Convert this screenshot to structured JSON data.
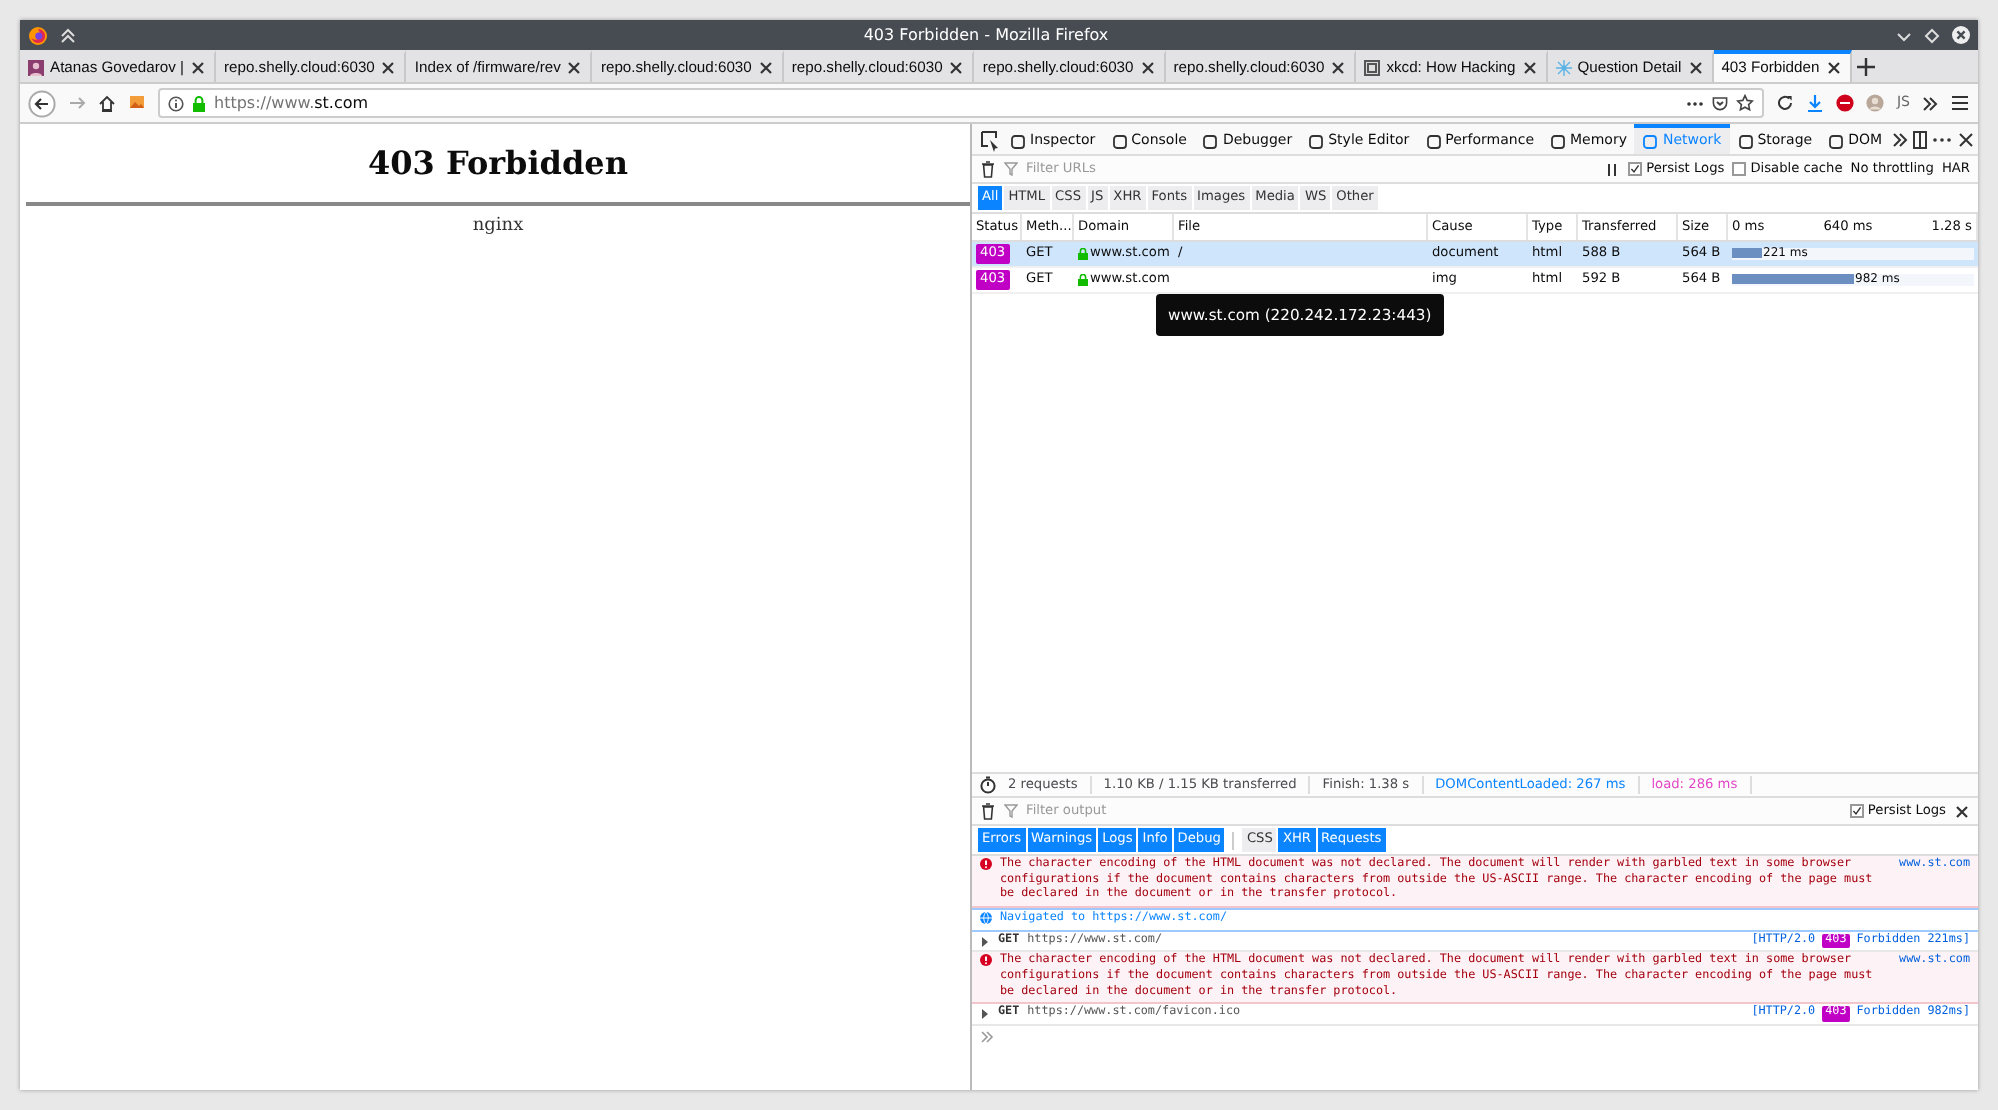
{
  "window": {
    "title": "403 Forbidden - Mozilla Firefox"
  },
  "tabs": [
    {
      "title": "Atanas Govedarov |",
      "kind": "avatar",
      "selected": false
    },
    {
      "title": "repo.shelly.cloud:6030",
      "kind": "plain",
      "selected": false
    },
    {
      "title": "Index of /firmware/rev",
      "kind": "plain",
      "selected": false
    },
    {
      "title": "repo.shelly.cloud:6030",
      "kind": "plain",
      "selected": false
    },
    {
      "title": "repo.shelly.cloud:6030",
      "kind": "plain",
      "selected": false
    },
    {
      "title": "repo.shelly.cloud:6030",
      "kind": "plain",
      "selected": false
    },
    {
      "title": "repo.shelly.cloud:6030",
      "kind": "plain",
      "selected": false
    },
    {
      "title": "xkcd: How Hacking",
      "kind": "comic",
      "selected": false
    },
    {
      "title": "Question Detail",
      "kind": "network",
      "selected": false
    },
    {
      "title": "403 Forbidden",
      "kind": "plain",
      "selected": true
    }
  ],
  "address_bar": {
    "url_prefix": "https://www.",
    "url_host": "st.com"
  },
  "toolbar": {
    "js_button": "JS"
  },
  "page": {
    "heading": "403 Forbidden",
    "footer": "nginx"
  },
  "devtools": {
    "tools": [
      {
        "label": "Inspector",
        "selected": false
      },
      {
        "label": "Console",
        "selected": false
      },
      {
        "label": "Debugger",
        "selected": false
      },
      {
        "label": "Style Editor",
        "selected": false
      },
      {
        "label": "Performance",
        "selected": false
      },
      {
        "label": "Memory",
        "selected": false
      },
      {
        "label": "Network",
        "selected": true
      },
      {
        "label": "Storage",
        "selected": false
      },
      {
        "label": "DOM",
        "selected": false
      }
    ],
    "network": {
      "filter_placeholder": "Filter URLs",
      "persist_logs": {
        "label": "Persist Logs",
        "checked": true
      },
      "disable_cache": {
        "label": "Disable cache",
        "checked": false
      },
      "throttling": "No throttling",
      "har": "HAR",
      "type_filters": [
        {
          "label": "All",
          "selected": true
        },
        {
          "label": "HTML",
          "selected": false
        },
        {
          "label": "CSS",
          "selected": false
        },
        {
          "label": "JS",
          "selected": false
        },
        {
          "label": "XHR",
          "selected": false
        },
        {
          "label": "Fonts",
          "selected": false
        },
        {
          "label": "Images",
          "selected": false
        },
        {
          "label": "Media",
          "selected": false
        },
        {
          "label": "WS",
          "selected": false
        },
        {
          "label": "Other",
          "selected": false
        }
      ],
      "columns": [
        "Status",
        "Meth...",
        "Domain",
        "File",
        "Cause",
        "Type",
        "Transferred",
        "Size"
      ],
      "timeline_ticks": [
        "0 ms",
        "640 ms",
        "1.28 s"
      ],
      "rows": [
        {
          "status": "403",
          "method": "GET",
          "domain": "www.st.com",
          "file": "/",
          "cause": "document",
          "type": "html",
          "transferred": "588 B",
          "size": "564 B",
          "timing": "221 ms",
          "level": 0.12,
          "selected": true
        },
        {
          "status": "403",
          "method": "GET",
          "domain": "www.st.com",
          "cause": "img",
          "type": "html",
          "transferred": "592 B",
          "size": "564 B",
          "timing": "982 ms",
          "level": 0.5,
          "selected": false
        }
      ],
      "tooltip": "www.st.com (220.242.172.23:443)",
      "summary": [
        {
          "text": "2 requests",
          "color": "#4a4a4f"
        },
        {
          "text": "1.10 KB / 1.15 KB transferred",
          "color": "#4a4a4f"
        },
        {
          "text": "Finish: 1.38 s",
          "color": "#4a4a4f"
        },
        {
          "text": "DOMContentLoaded: 267 ms",
          "color": "#0a84ff"
        },
        {
          "text": "load: 286 ms",
          "color": "#e344c6"
        }
      ]
    },
    "console": {
      "filter_placeholder": "Filter output",
      "persist_logs": {
        "label": "Persist Logs",
        "checked": true
      },
      "levels": [
        {
          "label": "Errors",
          "selected": true
        },
        {
          "label": "Warnings",
          "selected": true
        },
        {
          "label": "Logs",
          "selected": true
        },
        {
          "label": "Info",
          "selected": true
        },
        {
          "label": "Debug",
          "selected": true
        }
      ],
      "categories": [
        {
          "label": "CSS",
          "selected": false
        },
        {
          "label": "XHR",
          "selected": true
        },
        {
          "label": "Requests",
          "selected": true
        }
      ],
      "messages": [
        {
          "kind": "error",
          "text": "The character encoding of the HTML document was not declared. The document will render with garbled text in some browser configurations if the document contains characters from outside the US-ASCII range. The character encoding of the page must be declared in the document or in the transfer protocol.",
          "source": "www.st.com"
        },
        {
          "kind": "info",
          "text": "Navigated to https://www.st.com/"
        },
        {
          "kind": "request",
          "method": "GET",
          "url": "https://www.st.com/",
          "protocol": "[HTTP/2.0",
          "status": "403",
          "result": "Forbidden 221ms]"
        },
        {
          "kind": "error",
          "text": "The character encoding of the HTML document was not declared. The document will render with garbled text in some browser configurations if the document contains characters from outside the US-ASCII range. The character encoding of the page must be declared in the document or in the transfer protocol.",
          "source": "www.st.com"
        },
        {
          "kind": "request",
          "method": "GET",
          "url": "https://www.st.com/favicon.ico",
          "protocol": "[HTTP/2.0",
          "status": "403",
          "result": "Forbidden 982ms]"
        }
      ]
    }
  }
}
